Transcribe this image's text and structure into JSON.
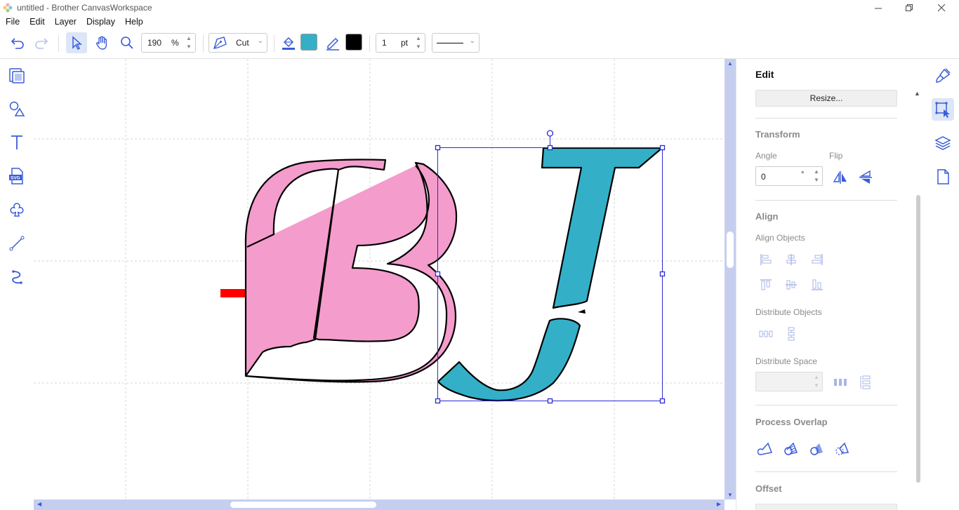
{
  "window": {
    "title": "untitled - Brother CanvasWorkspace"
  },
  "menu": {
    "file": "File",
    "edit": "Edit",
    "layer": "Layer",
    "display": "Display",
    "help": "Help"
  },
  "toolbar": {
    "zoom_value": "190",
    "zoom_unit": "%",
    "mode_value": "Cut",
    "fill_color": "#33b0c8",
    "line_color": "#000000",
    "line_width_value": "1",
    "line_width_unit": "pt"
  },
  "canvas": {
    "letter_b_color": "#f49ccc",
    "letter_j_color": "#33b0c8",
    "arrow_color": "#ff0000"
  },
  "panel": {
    "title": "Edit",
    "resize_label": "Resize...",
    "transform": {
      "title": "Transform",
      "angle_label": "Angle",
      "angle_value": "0",
      "angle_unit": "°",
      "flip_label": "Flip"
    },
    "align": {
      "title": "Align",
      "align_objects_label": "Align Objects",
      "distribute_objects_label": "Distribute Objects",
      "distribute_space_label": "Distribute Space"
    },
    "process_overlap_title": "Process Overlap",
    "offset_title": "Offset"
  },
  "colors": {
    "accent": "#3a5bd9",
    "scrollbar": "#c6cef0",
    "icon_disabled": "#a9b6e6"
  }
}
